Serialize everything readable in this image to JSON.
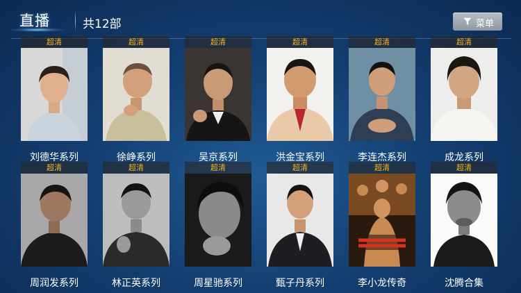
{
  "header": {
    "title": "直播",
    "count": "共12部",
    "menu_label": "菜单"
  },
  "colors": {
    "badge_text": "#f4b327",
    "background": "#143f72"
  },
  "items": [
    {
      "name": "刘德华系列",
      "badge": "超清"
    },
    {
      "name": "徐峥系列",
      "badge": "超清"
    },
    {
      "name": "吴京系列",
      "badge": "超清"
    },
    {
      "name": "洪金宝系列",
      "badge": "超清"
    },
    {
      "name": "李连杰系列",
      "badge": "超清"
    },
    {
      "name": "成龙系列",
      "badge": "超清"
    },
    {
      "name": "周润发系列",
      "badge": "超清"
    },
    {
      "name": "林正英系列",
      "badge": "超清"
    },
    {
      "name": "周星驰系列",
      "badge": "超清"
    },
    {
      "name": "甄子丹系列",
      "badge": "超清"
    },
    {
      "name": "李小龙传奇",
      "badge": "超清"
    },
    {
      "name": "沈腾合集",
      "badge": "超清"
    }
  ]
}
